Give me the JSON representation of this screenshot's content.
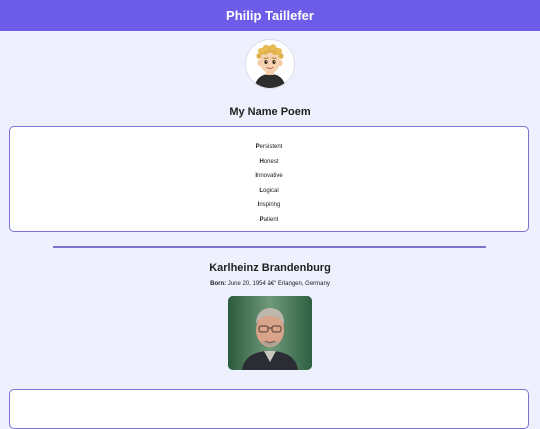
{
  "header": {
    "title": "Philip Taillefer"
  },
  "poem": {
    "title": "My Name Poem",
    "lines": [
      {
        "first": "P",
        "rest": "ersistent"
      },
      {
        "first": "H",
        "rest": "onest"
      },
      {
        "first": "I",
        "rest": "nnovative"
      },
      {
        "first": "L",
        "rest": "ogical"
      },
      {
        "first": "I",
        "rest": "nspiring"
      },
      {
        "first": "P",
        "rest": "atient"
      }
    ]
  },
  "bio": {
    "name": "Karlheinz Brandenburg",
    "born_label": "Born:",
    "born_value": " June 20, 1954 â€“ Erlangen, Germany"
  }
}
